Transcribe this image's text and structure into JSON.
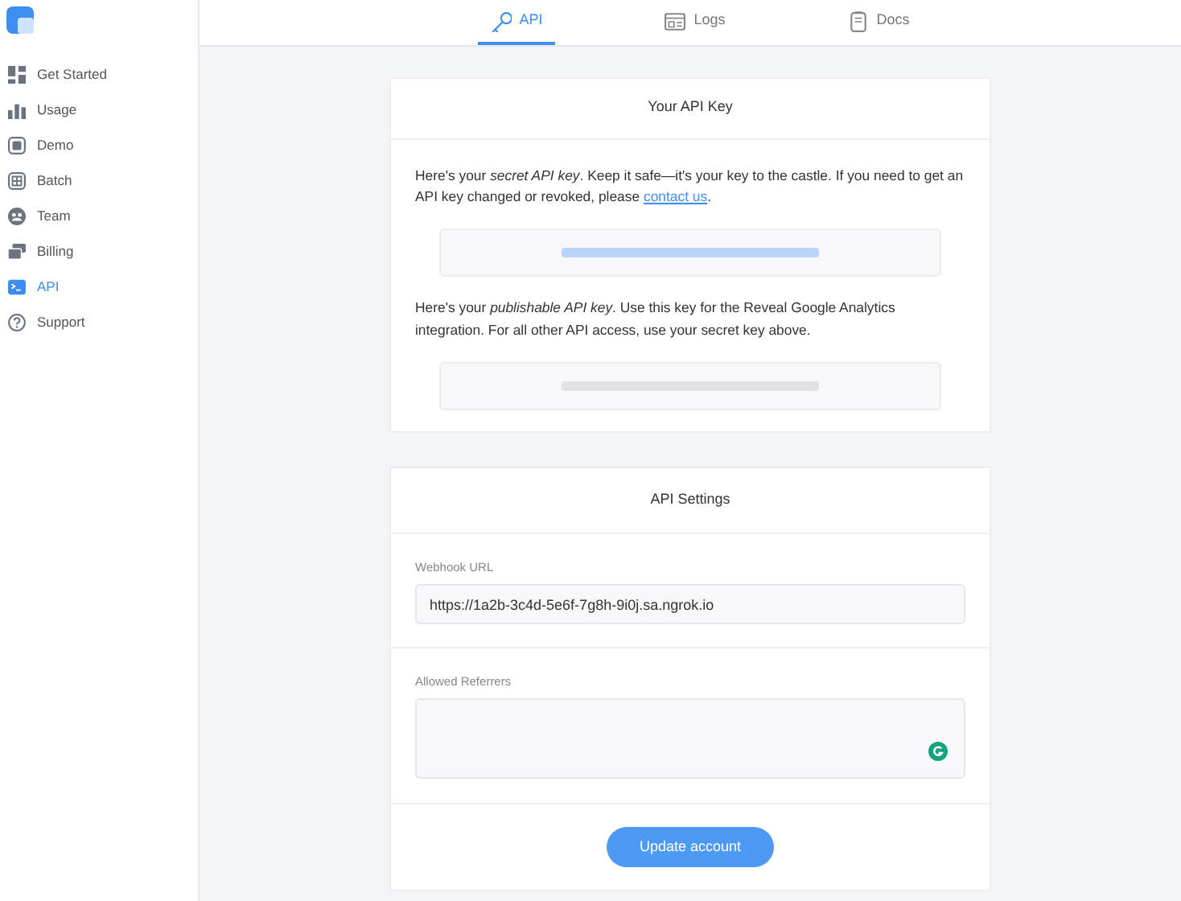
{
  "sidebar": {
    "items": [
      {
        "label": "Get Started",
        "selected": false
      },
      {
        "label": "Usage",
        "selected": false
      },
      {
        "label": "Demo",
        "selected": false
      },
      {
        "label": "Batch",
        "selected": false
      },
      {
        "label": "Team",
        "selected": false
      },
      {
        "label": "Billing",
        "selected": false
      },
      {
        "label": "API",
        "selected": true
      },
      {
        "label": "Support",
        "selected": false
      }
    ]
  },
  "tabs": [
    {
      "label": "API",
      "selected": true
    },
    {
      "label": "Logs",
      "selected": false
    },
    {
      "label": "Docs",
      "selected": false
    }
  ],
  "api_key_card": {
    "title": "Your API Key",
    "secret_text": {
      "before": "Here's your *secret API key*. Keep it safe—it's your key to the castle. If you need to get an API key changed or revoked, please ",
      "link": "contact us",
      "after": "."
    },
    "secret_key": {
      "highlighted": true
    },
    "publishable_text": "Here's your *publishable API key*. Use this key for the Reveal Google Analytics integration. For all other API access, use your secret key above.",
    "publishable_key": {
      "highlighted": false
    }
  },
  "settings_card": {
    "title": "API Settings",
    "webhook": {
      "label": "Webhook URL",
      "value": "https://1a2b-3c4d-5e6f-7g8h-9i0j.sa.ngrok.io"
    },
    "referrers": {
      "label": "Allowed Referrers"
    },
    "button": "Update account"
  }
}
